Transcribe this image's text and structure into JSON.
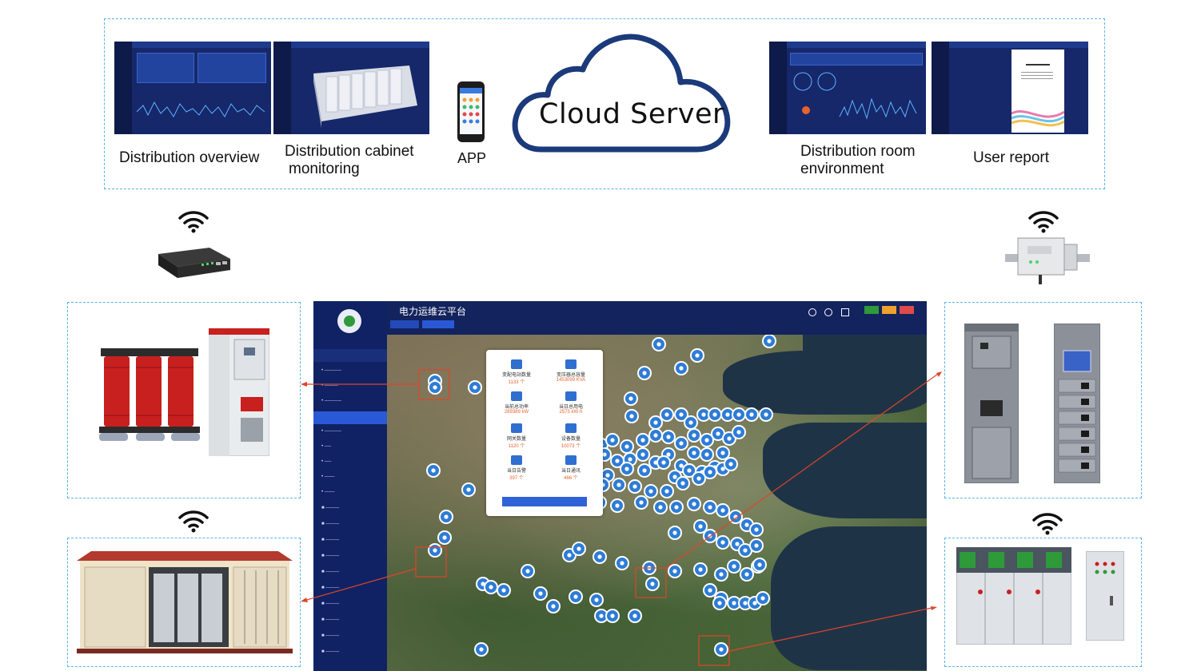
{
  "top_panel": {
    "captions": {
      "distribution_overview": "Distribution overview",
      "cabinet_line1": "Distribution cabinet",
      "cabinet_line2": "monitoring",
      "app": "APP",
      "room_line1": "Distribution room",
      "room_line2": "environment",
      "user_report": "User report"
    },
    "cloud_label": "Cloud Server"
  },
  "platform": {
    "title": "电力运维云平台",
    "stats": [
      {
        "label": "变配电站数量",
        "value": "1133 个"
      },
      {
        "label": "变压器总容量",
        "value": "1453099 KVA"
      },
      {
        "label": "当前总功率",
        "value": "289389 kW"
      },
      {
        "label": "当日总用电",
        "value": "2575  kW·h"
      },
      {
        "label": "网关数量",
        "value": "1120 个"
      },
      {
        "label": "设备数量",
        "value": "10073 个"
      },
      {
        "label": "当日告警",
        "value": "397 个"
      },
      {
        "label": "当日通讯",
        "value": "466 个"
      }
    ],
    "button_label": ""
  },
  "colors": {
    "dashed_border": "#5ab4e5",
    "cloud_stroke": "#1b3a7a",
    "screen_bg": "#0f1b4d",
    "pin": "#2e7cd6",
    "highlight": "#e0442a",
    "transformer_red": "#c8201f"
  },
  "icons": [
    "wifi-icon",
    "gateway-device-icon",
    "cloud-icon",
    "phone-icon",
    "map-pin-icon"
  ]
}
